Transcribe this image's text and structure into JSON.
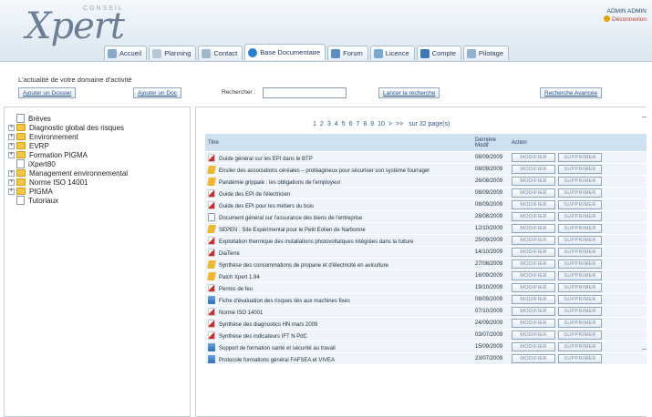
{
  "header": {
    "logo_small": "CONSEIL",
    "logo_main": "Xpert",
    "user_name": "ADMIN ADMIN",
    "logout_label": "Déconnexion"
  },
  "nav": {
    "tabs": [
      {
        "label": "Accueil",
        "icon": "home-icon",
        "active": false
      },
      {
        "label": "Planning",
        "icon": "calendar-icon",
        "active": false
      },
      {
        "label": "Contact",
        "icon": "contact-icon",
        "active": false
      },
      {
        "label": "Base Documentaire",
        "icon": "globe-icon",
        "active": true
      },
      {
        "label": "Forum",
        "icon": "forum-icon",
        "active": false
      },
      {
        "label": "Licence",
        "icon": "licence-icon",
        "active": false
      },
      {
        "label": "Compte",
        "icon": "user-icon",
        "active": false
      },
      {
        "label": "Pilotage",
        "icon": "chart-icon",
        "active": false
      }
    ]
  },
  "subtitle": "L'actualité de votre domaine d'activité",
  "toolbar": {
    "add_folder": "Ajouter un Dossier",
    "add_doc": "Ajouter un Doc",
    "search_label": "Rechercher :",
    "search_value": "",
    "search_button": "Lancer la recherche",
    "advanced_search": "Recherche Avancée"
  },
  "tree": [
    {
      "label": "Brèves",
      "expandable": false,
      "type": "doc"
    },
    {
      "label": "Diagnostic global des risques",
      "expandable": true,
      "type": "folder"
    },
    {
      "label": "Environnement",
      "expandable": true,
      "type": "folder"
    },
    {
      "label": "EVRP",
      "expandable": true,
      "type": "folder"
    },
    {
      "label": "Formation PIGMA",
      "expandable": true,
      "type": "folder"
    },
    {
      "label": "iXpert80",
      "expandable": false,
      "type": "doc"
    },
    {
      "label": "Management environnemental",
      "expandable": true,
      "type": "folder"
    },
    {
      "label": "Norme ISO 14001",
      "expandable": true,
      "type": "folder"
    },
    {
      "label": "PIGMA",
      "expandable": true,
      "type": "folder"
    },
    {
      "label": "Tutoriaux",
      "expandable": false,
      "type": "doc"
    }
  ],
  "pagination": {
    "pages": [
      "1",
      "2",
      "3",
      "4",
      "5",
      "6",
      "7",
      "8",
      "9",
      "10"
    ],
    "next": ">",
    "last": ">>",
    "summary": "sur 32 page(s)"
  },
  "table": {
    "headers": {
      "title": "Titre",
      "date": "Dernière Modif",
      "action": "Action"
    },
    "modify_label": "MODIFIER",
    "delete_label": "SUPPRIMER",
    "rows": [
      {
        "icon": "pdf",
        "title": "Guide général sur les EPI dans le BTP",
        "date": "08/09/2009"
      },
      {
        "icon": "note",
        "title": "Ensiler des associations céréales – protéagineux pour sécuriser son système fourrager",
        "date": "08/09/2009"
      },
      {
        "icon": "note",
        "title": "Pandémie grippale : les obligations de l'employeur",
        "date": "26/08/2009"
      },
      {
        "icon": "pdf",
        "title": "Guide des EPI de l'électricien",
        "date": "08/09/2009"
      },
      {
        "icon": "pdf",
        "title": "Guide des EPI pour les métiers du bois",
        "date": "08/09/2009"
      },
      {
        "icon": "doc",
        "title": "Document général sur l'assurance des biens de l'entreprise",
        "date": "28/08/2009"
      },
      {
        "icon": "note",
        "title": "SEPEN : Site Expérimental pour le Petit Eolien de Narbonne",
        "date": "12/10/2009"
      },
      {
        "icon": "pdf",
        "title": "Exploitation thermique des installations photovoltaïques intégrées dans la toiture",
        "date": "25/09/2009"
      },
      {
        "icon": "pdf",
        "title": "DiaTerre",
        "date": "14/10/2009"
      },
      {
        "icon": "note",
        "title": "Synthèse des consommations de propane et d'électricité en aviculture",
        "date": "27/08/2009"
      },
      {
        "icon": "note",
        "title": "Patch Xpert 1.94",
        "date": "16/09/2009"
      },
      {
        "icon": "pdf",
        "title": "Permis de feu",
        "date": "19/10/2009"
      },
      {
        "icon": "img",
        "title": "Fiche d'évaluation des risques liés aux machines fixes",
        "date": "08/09/2009"
      },
      {
        "icon": "pdf",
        "title": "Norme ISO 14001",
        "date": "07/10/2009"
      },
      {
        "icon": "pdf",
        "title": "Synthèse des diagnostics HN mars 2009",
        "date": "24/09/2009"
      },
      {
        "icon": "pdf",
        "title": "Synthèse des indicateurs IFT N PdC",
        "date": "03/07/2009"
      },
      {
        "icon": "img",
        "title": "Support de formation santé et sécurité au travail",
        "date": "15/09/2009"
      },
      {
        "icon": "img",
        "title": "Protocole formations général FAFSEA et VIVEA",
        "date": "23/07/2009"
      }
    ]
  }
}
